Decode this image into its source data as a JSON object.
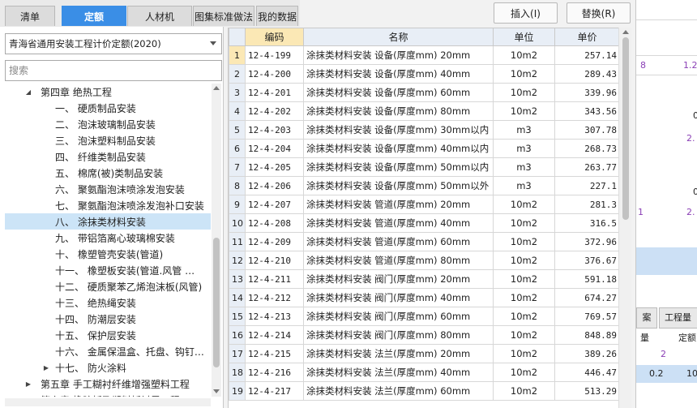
{
  "tabs": [
    "清单",
    "定额",
    "人材机",
    "图集标准做法",
    "我的数据"
  ],
  "active_tab": 1,
  "buttons": {
    "insert": "插入(I)",
    "replace": "替换(R)"
  },
  "quota_select": {
    "value": "青海省通用安装工程计价定额(2020)"
  },
  "search": {
    "placeholder": "搜索"
  },
  "tree": [
    {
      "label": "第四章 绝热工程",
      "level": 0,
      "expanded": true
    },
    {
      "label": "一、 硬质制品安装",
      "level": 1
    },
    {
      "label": "二、 泡沫玻璃制品安装",
      "level": 1
    },
    {
      "label": "三、 泡沫塑料制品安装",
      "level": 1
    },
    {
      "label": "四、 纤维类制品安装",
      "level": 1
    },
    {
      "label": "五、 棉席(被)类制品安装",
      "level": 1
    },
    {
      "label": "六、 聚氨酯泡沫喷涂发泡安装",
      "level": 1
    },
    {
      "label": "七、 聚氨酯泡沫喷涂发泡补口安装",
      "level": 1
    },
    {
      "label": "八、 涂抹类材料安装",
      "level": 1,
      "selected": true
    },
    {
      "label": "九、 带铝箔离心玻璃棉安装",
      "level": 1
    },
    {
      "label": "十、 橡塑管壳安装(管道)",
      "level": 1
    },
    {
      "label": "十一、 橡塑板安装(管道.风管 …",
      "level": 1
    },
    {
      "label": "十二、 硬质聚苯乙烯泡沫板(风管)",
      "level": 1
    },
    {
      "label": "十三、 绝热绳安装",
      "level": 1
    },
    {
      "label": "十四、 防潮层安装",
      "level": 1
    },
    {
      "label": "十五、 保护层安装",
      "level": 1
    },
    {
      "label": "十六、 金属保温盒、托盘、钩钉…",
      "level": 1
    },
    {
      "label": "十七、 防火涂料",
      "level": 1,
      "collapsed": true
    },
    {
      "label": "第五章 手工糊衬纤维增强塑料工程",
      "level": 0,
      "collapsed": true
    },
    {
      "label": "第六章 橡胶板及塑料板衬里工程",
      "level": 0,
      "collapsed": true
    }
  ],
  "grid": {
    "headers": [
      "",
      "编码",
      "名称",
      "单位",
      "单价"
    ],
    "rows": [
      [
        "1",
        "12-4-199",
        "涂抹类材料安装 设备(厚度mm) 20mm",
        "10m2",
        "257.14"
      ],
      [
        "2",
        "12-4-200",
        "涂抹类材料安装 设备(厚度mm) 40mm",
        "10m2",
        "289.43"
      ],
      [
        "3",
        "12-4-201",
        "涂抹类材料安装 设备(厚度mm) 60mm",
        "10m2",
        "339.96"
      ],
      [
        "4",
        "12-4-202",
        "涂抹类材料安装 设备(厚度mm) 80mm",
        "10m2",
        "343.56"
      ],
      [
        "5",
        "12-4-203",
        "涂抹类材料安装 设备(厚度mm) 30mm以内",
        "m3",
        "307.78"
      ],
      [
        "6",
        "12-4-204",
        "涂抹类材料安装 设备(厚度mm) 40mm以内",
        "m3",
        "268.73"
      ],
      [
        "7",
        "12-4-205",
        "涂抹类材料安装 设备(厚度mm) 50mm以内",
        "m3",
        "263.77"
      ],
      [
        "8",
        "12-4-206",
        "涂抹类材料安装 设备(厚度mm) 50mm以外",
        "m3",
        "227.1"
      ],
      [
        "9",
        "12-4-207",
        "涂抹类材料安装 管道(厚度mm) 20mm",
        "10m2",
        "281.3"
      ],
      [
        "10",
        "12-4-208",
        "涂抹类材料安装 管道(厚度mm) 40mm",
        "10m2",
        "316.5"
      ],
      [
        "11",
        "12-4-209",
        "涂抹类材料安装 管道(厚度mm) 60mm",
        "10m2",
        "372.96"
      ],
      [
        "12",
        "12-4-210",
        "涂抹类材料安装 管道(厚度mm) 80mm",
        "10m2",
        "376.67"
      ],
      [
        "13",
        "12-4-211",
        "涂抹类材料安装 阀门(厚度mm) 20mm",
        "10m2",
        "591.18"
      ],
      [
        "14",
        "12-4-212",
        "涂抹类材料安装 阀门(厚度mm) 40mm",
        "10m2",
        "674.27"
      ],
      [
        "15",
        "12-4-213",
        "涂抹类材料安装 阀门(厚度mm) 60mm",
        "10m2",
        "769.57"
      ],
      [
        "16",
        "12-4-214",
        "涂抹类材料安装 阀门(厚度mm) 80mm",
        "10m2",
        "848.89"
      ],
      [
        "17",
        "12-4-215",
        "涂抹类材料安装 法兰(厚度mm) 20mm",
        "10m2",
        "389.26"
      ],
      [
        "18",
        "12-4-216",
        "涂抹类材料安装 法兰(厚度mm) 40mm",
        "10m2",
        "446.47"
      ],
      [
        "19",
        "12-4-217",
        "涂抹类材料安装 法兰(厚度mm) 60mm",
        "10m2",
        "513.29"
      ]
    ]
  },
  "background": {
    "values": [
      "8",
      "1.2",
      "0",
      "2.",
      "0",
      "1",
      "2.",
      "2",
      "0.2",
      "10"
    ],
    "tabs": [
      "案",
      "工程量"
    ],
    "headers": [
      "量",
      "定额"
    ]
  },
  "colors": {
    "accent": "#3a8ee6",
    "selected_row": "#cce4f7",
    "header_bg": "#e8eef6",
    "code_header": "#fbe8b5"
  }
}
